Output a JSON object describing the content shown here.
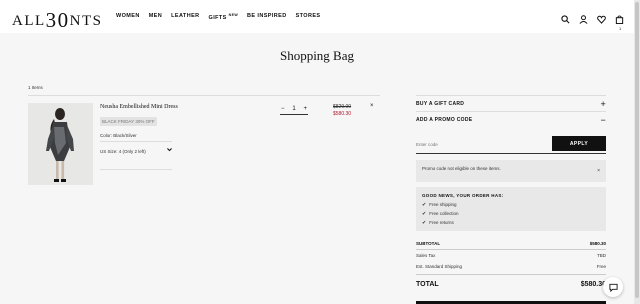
{
  "header": {
    "logo_prefix": "ALL",
    "logo_number": "30",
    "logo_suffix": "NTS",
    "nav": [
      {
        "label": "WOMEN"
      },
      {
        "label": "MEN"
      },
      {
        "label": "LEATHER"
      },
      {
        "label": "GIFTS",
        "badge": "NEW"
      },
      {
        "label": "BE INSPIRED"
      },
      {
        "label": "STORES"
      }
    ],
    "icons": [
      "search-icon",
      "account-icon",
      "wishlist-icon",
      "bag-icon"
    ],
    "bag_count": "1"
  },
  "page_title": "Shopping Bag",
  "bag": {
    "items_count": "1 Items",
    "item": {
      "name": "Neusha Embellished Mini Dress",
      "promo_badge": "BLACK FRIDAY 30% OFF",
      "color": "Color: Black/Silver",
      "size": "US Size: 4 (Only 2 left)",
      "qty_minus": "−",
      "qty": "1",
      "qty_plus": "+",
      "price_old": "$829.00",
      "price_new": "$580.30",
      "remove": "×"
    }
  },
  "summary": {
    "gift_card": "BUY A GIFT CARD",
    "gift_card_sign": "+",
    "promo": "ADD A PROMO CODE",
    "promo_sign": "−",
    "promo_placeholder": "Enter code",
    "apply": "APPLY",
    "notice": "Promo code not eligible on these items.",
    "notice_close": "×",
    "news_title": "GOOD NEWS, YOUR ORDER HAS:",
    "news_items": [
      "Free shipping",
      "Free collection",
      "Free returns"
    ],
    "subtotal_label": "SUBTOTAL",
    "subtotal_value": "$580.30",
    "tax_label": "Sales Tax",
    "tax_value": "TBD",
    "shipping_label": "Est. Standard Shipping",
    "shipping_value": "Free",
    "total_label": "TOTAL",
    "total_value": "$580.30"
  }
}
